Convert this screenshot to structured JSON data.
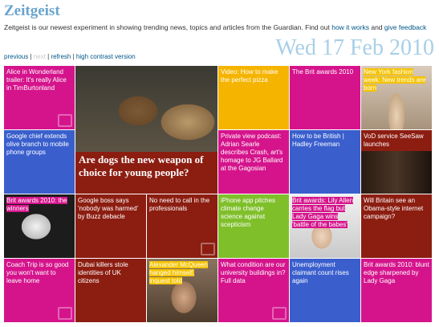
{
  "header": {
    "logo": "Zeitgeist",
    "intro_text": "Zeitgeist is our newest experiment in showing trending news, topics and articles from the Guardian. Find out ",
    "intro_link": "how it works",
    "intro_and": " and ",
    "feedback_link": "give feedback",
    "date": "Wed 17 Feb 2010"
  },
  "nav": {
    "previous": "previous",
    "next": "next",
    "refresh": "refresh",
    "high_contrast": "high contrast version",
    "sep": " | "
  },
  "tiles": [
    {
      "text": "Alice in Wonderland trailer: It's really Alice in TimBurtonland",
      "color": "#d5148c"
    },
    {
      "text": "Are dogs the new weapon of choice for young people?",
      "color": "#8c1d11"
    },
    {
      "text": "Video: How to make the perfect pizza",
      "color": "#f5b400"
    },
    {
      "text": "The Brit awards 2010",
      "color": "#d5148c"
    },
    {
      "text": "New York fashion week: New trends are born",
      "color": "#d5148c"
    },
    {
      "text": "Google chief extends olive branch to mobile phone groups",
      "color": "#3a5fcd"
    },
    {
      "text": "Private view podcast: Adrian Searle describes Crash, art's homage to JG Ballard at the Gagosian",
      "color": "#d5148c"
    },
    {
      "text": "How to be British | Hadley Freeman",
      "color": "#3a5fcd"
    },
    {
      "text": "VoD service SeeSaw launches",
      "color": "#8c1d11"
    },
    {
      "text": "Brit awards 2010: the winners",
      "color": "#d5148c"
    },
    {
      "text": "Google boss says 'nobody was harmed' by Buzz debacle",
      "color": "#8c1d11"
    },
    {
      "text": "No need to call in the professionals",
      "color": "#8c1d11"
    },
    {
      "text": "iPhone app pitches climate change science against scepticism",
      "color": "#7fbf2a"
    },
    {
      "text": "Brit awards: Lily Allen carries the flag but Lady Gaga wins 'battle of the babes'",
      "color": "#d5148c"
    },
    {
      "text": "Will Britain see an Obama-style internet campaign?",
      "color": "#8c1d11"
    },
    {
      "text": "Coach Trip is so good you won't want to leave home",
      "color": "#d5148c"
    },
    {
      "text": "Dubai killers stole identities of UK citizens",
      "color": "#8c1d11"
    },
    {
      "text": "Alexander McQueen hanged himself, inquest told",
      "color": "#f5b400"
    },
    {
      "text": "What condition are our university buildings in? Full data",
      "color": "#d5148c"
    },
    {
      "text": "Unemployment claimant count rises again",
      "color": "#3a5fcd"
    },
    {
      "text": "Brit awards 2010: blunt edge sharpened by Lady Gaga",
      "color": "#d5148c"
    }
  ]
}
